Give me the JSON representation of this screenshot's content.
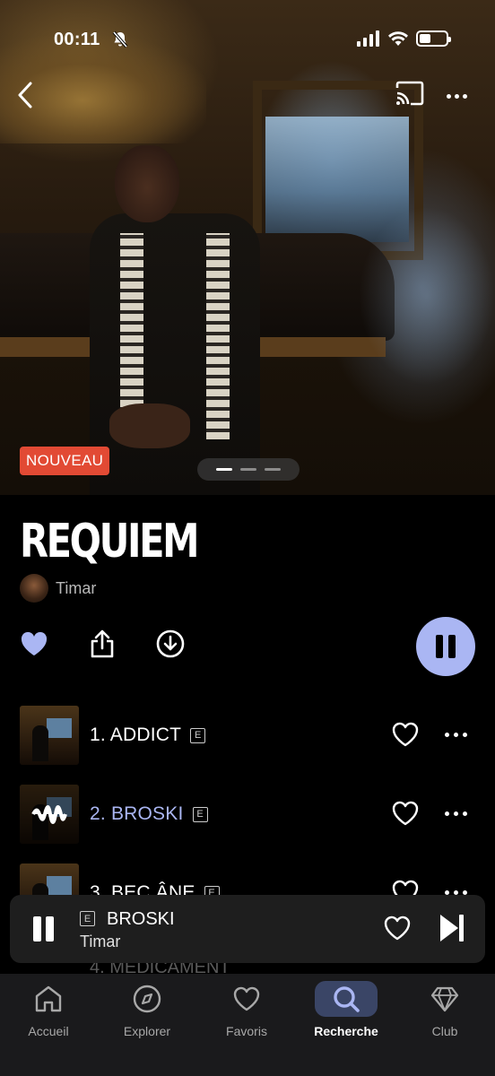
{
  "status_bar": {
    "time": "00:11"
  },
  "hero": {
    "badge": "NOUVEAU",
    "pager_total": 3,
    "pager_active": 1
  },
  "album": {
    "title": "REQUIEM",
    "artist": "Timar"
  },
  "tracks": [
    {
      "title": "1. ADDICT",
      "explicit": "E",
      "playing": false
    },
    {
      "title": "2. BROSKI",
      "explicit": "E",
      "playing": true
    },
    {
      "title": "3. BEC ÂNE",
      "explicit": "E",
      "playing": false
    }
  ],
  "under_track": {
    "title": "4. MÉDICAMENT"
  },
  "mini_player": {
    "explicit": "E",
    "title": "BROSKI",
    "artist": "Timar"
  },
  "tabs": [
    {
      "label": "Accueil",
      "icon": "home-icon"
    },
    {
      "label": "Explorer",
      "icon": "compass-icon"
    },
    {
      "label": "Favoris",
      "icon": "heart-icon"
    },
    {
      "label": "Recherche",
      "icon": "search-icon",
      "active": true
    },
    {
      "label": "Club",
      "icon": "diamond-icon"
    }
  ],
  "colors": {
    "accent": "#aab6f3",
    "badge": "#e24a34",
    "tabbar": "#1a1a1c",
    "mini_player": "#1e1e1e"
  }
}
